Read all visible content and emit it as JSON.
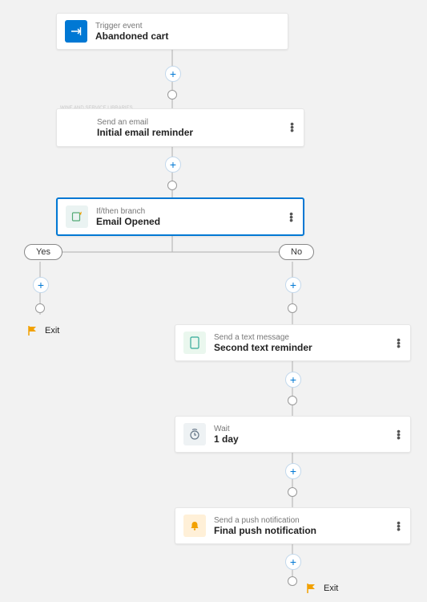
{
  "nodes": {
    "trigger": {
      "category": "Trigger event",
      "title": "Abandoned cart"
    },
    "email": {
      "category": "Send an email",
      "title": "Initial email reminder"
    },
    "branch": {
      "category": "If/then branch",
      "title": "Email Opened"
    },
    "sms": {
      "category": "Send a text message",
      "title": "Second text reminder"
    },
    "wait": {
      "category": "Wait",
      "title": "1 day"
    },
    "push": {
      "category": "Send a push notification",
      "title": "Final push notification"
    }
  },
  "branch_labels": {
    "yes": "Yes",
    "no": "No"
  },
  "exit_label": "Exit",
  "tiny_note": "WINE AND SERVICE LIBRARIES",
  "icons": {
    "trigger": "trigger-icon",
    "email": "email-icon",
    "branch": "branch-icon",
    "sms": "sms-icon",
    "wait": "wait-icon",
    "push": "push-icon",
    "flag": "flag-icon",
    "plus": "plus-icon",
    "menu": "menu-icon"
  },
  "colors": {
    "selection": "#0078d4",
    "flag": "#f2a100"
  }
}
